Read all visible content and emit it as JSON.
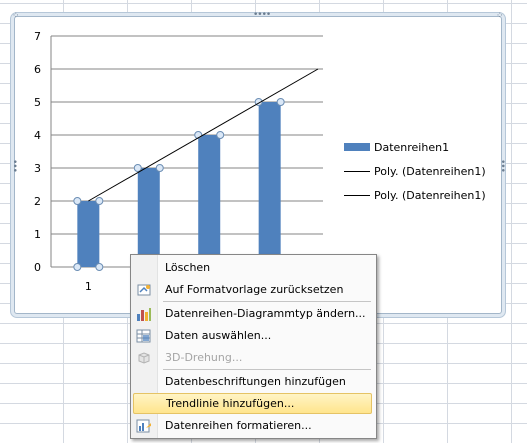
{
  "chart_data": {
    "type": "bar",
    "categories": [
      "1",
      "",
      "",
      ""
    ],
    "series": [
      {
        "name": "Datenreihen1",
        "values": [
          2,
          3,
          4,
          5
        ]
      }
    ],
    "trendline": {
      "type": "line",
      "start": [
        1,
        2
      ],
      "end": [
        4.8,
        6
      ]
    },
    "ylim": [
      0,
      7
    ],
    "yticks": [
      "0",
      "1",
      "2",
      "3",
      "4",
      "5",
      "6",
      "7"
    ],
    "grid": true,
    "legend_position": "right",
    "bar_color": "#4F81BD"
  },
  "legend": {
    "items": [
      {
        "label": "Datenreihen1",
        "kind": "bar"
      },
      {
        "label": "Poly. (Datenreihen1)",
        "kind": "line"
      },
      {
        "label": "Poly. (Datenreihen1)",
        "kind": "line"
      }
    ]
  },
  "context_menu": {
    "items": [
      {
        "label": "Löschen",
        "icon": "",
        "disabled": false,
        "active": false
      },
      {
        "label": "Auf Formatvorlage zurücksetzen",
        "icon": "reset-style-icon",
        "disabled": false,
        "active": false
      },
      {
        "label": "Datenreihen-Diagrammtyp ändern...",
        "icon": "chart-type-icon",
        "disabled": false,
        "active": false
      },
      {
        "label": "Daten auswählen...",
        "icon": "select-data-icon",
        "disabled": false,
        "active": false
      },
      {
        "label": "3D-Drehung...",
        "icon": "3d-rotation-icon",
        "disabled": true,
        "active": false
      },
      {
        "label": "Datenbeschriftungen hinzufügen",
        "icon": "",
        "disabled": false,
        "active": false
      },
      {
        "label": "Trendlinie hinzufügen...",
        "icon": "",
        "disabled": false,
        "active": true
      },
      {
        "label": "Datenreihen formatieren...",
        "icon": "format-series-icon",
        "disabled": false,
        "active": false
      }
    ]
  }
}
